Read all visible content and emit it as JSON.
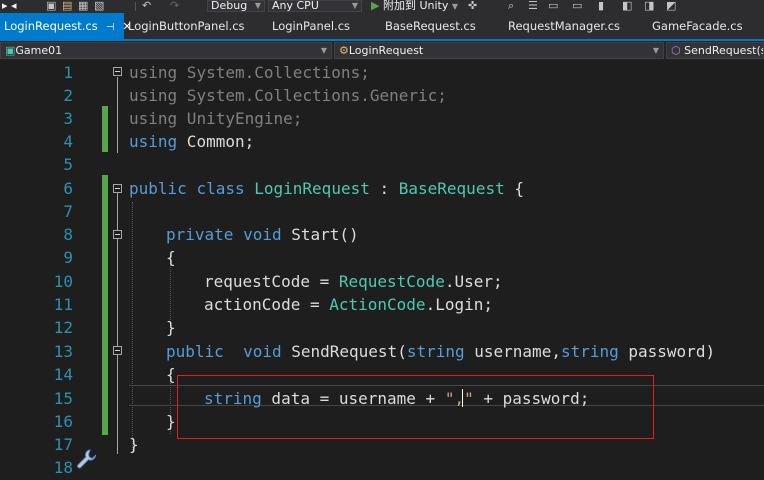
{
  "toolbar": {
    "config": "Debug",
    "platform": "Any CPU",
    "attach_label": "附加到 Unity"
  },
  "tabs": [
    {
      "label": "LoginRequest.cs",
      "active": true
    },
    {
      "label": "LoginButtonPanel.cs"
    },
    {
      "label": "LoginPanel.cs"
    },
    {
      "label": "BaseRequest.cs"
    },
    {
      "label": "RequestManager.cs"
    },
    {
      "label": "GameFacade.cs"
    }
  ],
  "nav": {
    "project": "Game01",
    "class": "LoginRequest",
    "member": "SendRequest(str"
  },
  "line_numbers": [
    "1",
    "2",
    "3",
    "4",
    "5",
    "6",
    "7",
    "8",
    "9",
    "10",
    "11",
    "12",
    "13",
    "14",
    "15",
    "16",
    "17",
    "18"
  ],
  "code": {
    "l1": {
      "kw": "using",
      "rest": " System.Collections;"
    },
    "l2": {
      "kw": "using",
      "rest": " System.Collections.Generic;"
    },
    "l3": {
      "kw": "using",
      "rest": " UnityEngine;"
    },
    "l4": {
      "kw": "using",
      "rest": " Common;"
    },
    "l6": {
      "kw1": "public",
      "kw2": "class",
      "name": "LoginRequest",
      "colon": " : ",
      "base": "BaseRequest",
      "brace": " {"
    },
    "l8": {
      "kw1": "private",
      "kw2": "void",
      "name": " Start()"
    },
    "l9": "{",
    "l10": {
      "pre": "requestCode = ",
      "type": "RequestCode",
      "post": ".User;"
    },
    "l11": {
      "pre": "actionCode = ",
      "type": "ActionCode",
      "post": ".Login;"
    },
    "l12": "}",
    "l13": {
      "kw1": "public",
      "kw2": "void",
      "name": " SendRequest(",
      "kw3": "string",
      "p1": " username,",
      "kw4": "string",
      "p2": " password)"
    },
    "l14": "{",
    "l15": {
      "kw": "string",
      "pre": " data = username + ",
      "str1": "\",",
      "str2": "\"",
      "post": " + password;"
    },
    "l16": "}",
    "l17": "}"
  }
}
